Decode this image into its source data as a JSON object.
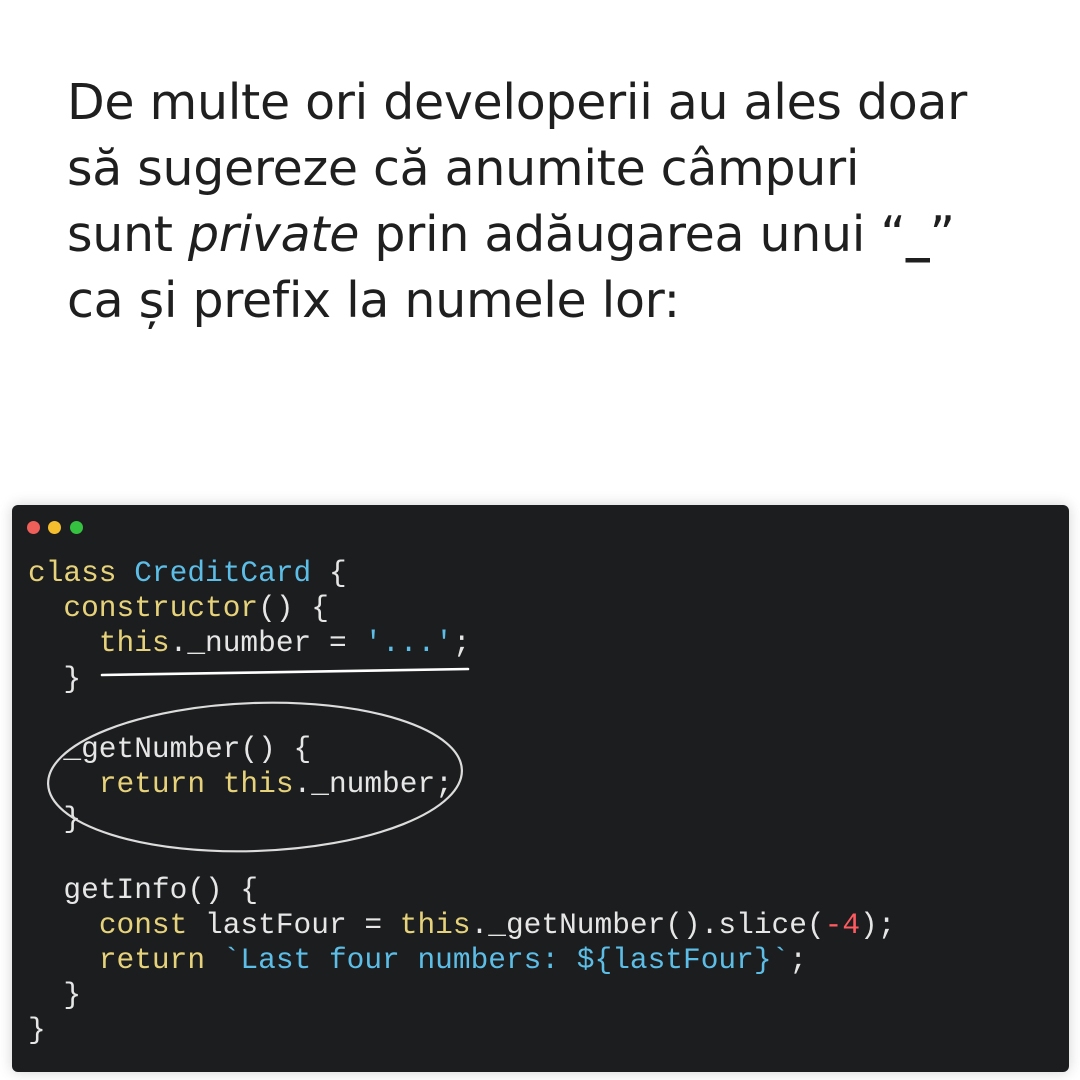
{
  "heading": {
    "line1": "De multe ori developerii au ales doar",
    "line2": "să sugereze că anumite câmpuri",
    "line3_prefix": "sunt ",
    "line3_italic": "private",
    "line3_mid": " prin adăugarea unui “",
    "line3_underscore": "_",
    "line3_close": "”",
    "line4": "ca și prefix la numele lor:"
  },
  "window_controls": [
    "close-dot",
    "minimize-dot",
    "maximize-dot"
  ],
  "code": {
    "l1": {
      "kw": "class",
      "sp": " ",
      "cls": "CreditCard",
      "rest": " {"
    },
    "l2": {
      "indent": "  ",
      "kw": "constructor",
      "rest": "() {"
    },
    "l3": {
      "indent": "    ",
      "kw": "this",
      "mid": "._number = ",
      "str": "'...'",
      "rest": ";"
    },
    "l4": {
      "text": "  }"
    },
    "l5": {
      "text": ""
    },
    "l6": {
      "text": "  _getNumber() {"
    },
    "l7": {
      "indent": "    ",
      "kw1": "return",
      "sp": " ",
      "kw2": "this",
      "rest": "._number;"
    },
    "l8": {
      "text": "  }"
    },
    "l9": {
      "text": ""
    },
    "l10": {
      "text": "  getInfo() {"
    },
    "l11": {
      "indent": "    ",
      "kw1": "const",
      "mid1": " lastFour = ",
      "kw2": "this",
      "mid2": "._getNumber().slice(",
      "num": "-4",
      "rest": ");"
    },
    "l12": {
      "indent": "    ",
      "kw": "return",
      "sp": " ",
      "str": "`Last four numbers: ${lastFour}`",
      "rest": ";"
    },
    "l13": {
      "text": "  }"
    },
    "l14": {
      "text": "}"
    }
  },
  "colors": {
    "background": "#ffffff",
    "code_background": "#1c1d1f",
    "keyword": "#e6d27a",
    "class_and_string": "#5cbde6",
    "number": "#ff5a5f",
    "plain_code": "#e6e6e6",
    "annotation": "#ffffff"
  }
}
